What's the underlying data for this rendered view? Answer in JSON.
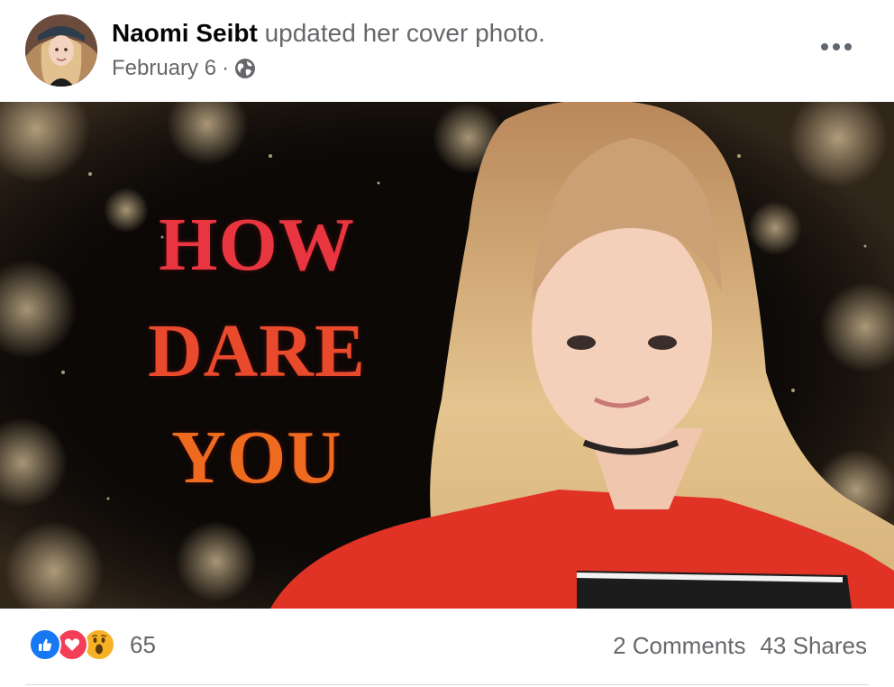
{
  "post": {
    "author_name": "Naomi Seibt",
    "action_text": "updated her cover photo.",
    "date": "February 6",
    "separator": "·",
    "privacy_icon": "globe-icon",
    "more_icon": "more-options-icon"
  },
  "cover_photo": {
    "lines": [
      "HOW",
      "DARE",
      "YOU"
    ]
  },
  "engagement": {
    "reaction_icons": [
      "like-icon",
      "love-icon",
      "wow-icon"
    ],
    "reaction_count": "65",
    "comments": "2 Comments",
    "shares": "43 Shares"
  },
  "colors": {
    "like": "#1877f2",
    "love": "#f33e58",
    "wow": "#f7b125",
    "secondary_text": "#65676b",
    "primary_text": "#050505"
  }
}
